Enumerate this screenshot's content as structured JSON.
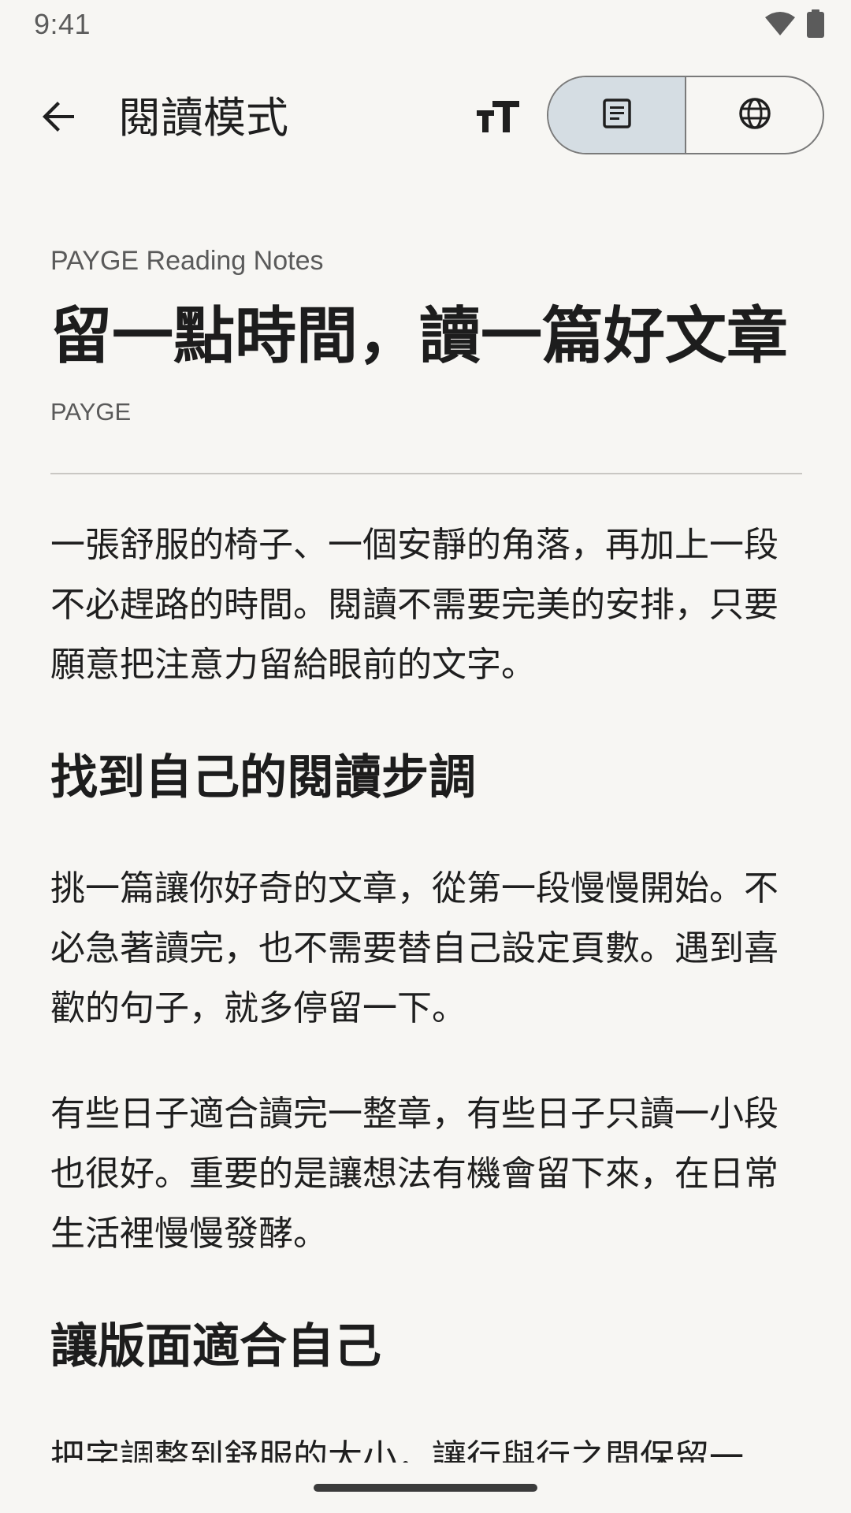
{
  "status_bar": {
    "time": "9:41",
    "icons": [
      "wifi-icon",
      "battery-icon"
    ]
  },
  "app_bar": {
    "back_icon": "arrow-back-icon",
    "title": "閱讀模式",
    "text_size_icon": "text-size-icon",
    "view_toggle": [
      {
        "icon": "reader-view-icon",
        "selected": true
      },
      {
        "icon": "web-view-icon",
        "selected": false
      }
    ]
  },
  "article": {
    "site_name": "PAYGE Reading Notes",
    "title": "留一點時間，讀一篇好文章",
    "author": "PAYGE",
    "intro": "一張舒服的椅子、一個安靜的角落，再加上一段不必趕路的時間。閱讀不需要完美的安排，只要願意把注意力留給眼前的文字。",
    "section1_heading": "找到自己的閱讀步調",
    "section1_para1": "挑一篇讓你好奇的文章，從第一段慢慢開始。不必急著讀完，也不需要替自己設定頁數。遇到喜歡的句子，就多停留一下。",
    "section1_para2": "有些日子適合讀完一整章，有些日子只讀一小段也很好。重要的是讓想法有機會留下來，在日常生活裡慢慢發酵。",
    "section2_heading": "讓版面適合自己",
    "section2_para1": "把字調整到舒服的大小，讓行與行之間保留一"
  },
  "colors": {
    "background": "#f7f6f3",
    "selected_segment": "#d5dde3",
    "text": "#1f1f1f",
    "muted_text": "#5a5a5a"
  }
}
